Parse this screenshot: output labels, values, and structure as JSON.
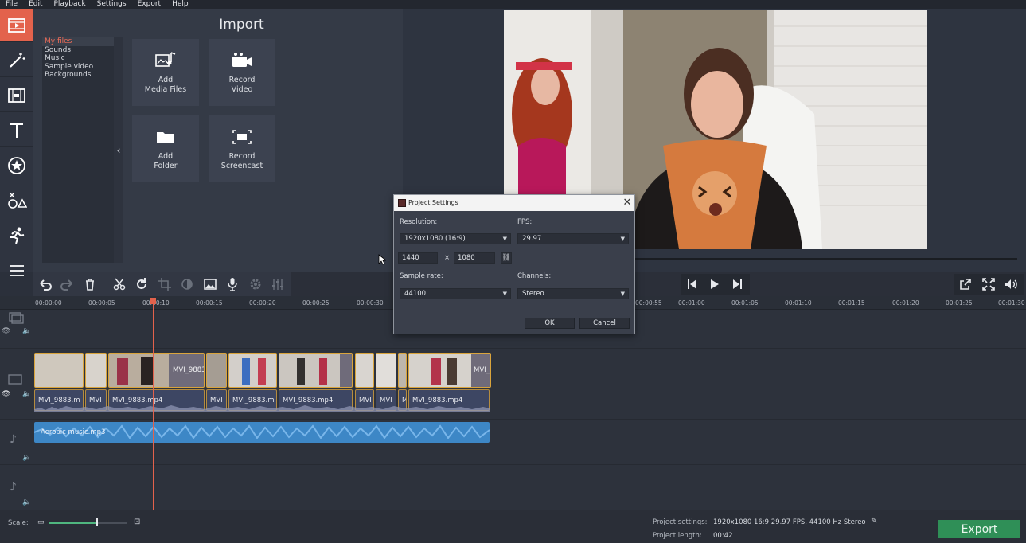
{
  "menu": [
    "File",
    "Edit",
    "Playback",
    "Settings",
    "Export",
    "Help"
  ],
  "import_panel": {
    "title": "Import",
    "file_list": [
      "My files",
      "Sounds",
      "Music",
      "Sample video",
      "Backgrounds"
    ],
    "tiles": [
      {
        "label": "Add\nMedia Files",
        "icon": "media-files-icon"
      },
      {
        "label": "Record\nVideo",
        "icon": "camera-icon"
      },
      {
        "label": "Add\nFolder",
        "icon": "folder-icon"
      },
      {
        "label": "Record\nScreencast",
        "icon": "screencast-icon"
      }
    ]
  },
  "ruler": [
    "00:00:00",
    "00:00:05",
    "00:00:10",
    "00:00:15",
    "00:00:20",
    "00:00:25",
    "00:00:30",
    "00:00:55",
    "00:01:00",
    "00:01:05",
    "00:01:10",
    "00:01:15",
    "00:01:20",
    "00:01:25",
    "00:01:30"
  ],
  "clips": {
    "video_label": "MVI_9883",
    "audio_labels": [
      "MVI_9883.m",
      "MVI",
      "MVI_9883.mp4",
      "MVI",
      "MVI_9883.m",
      "MVI_9883.mp4",
      "MVI",
      "MVI",
      "M",
      "MVI_9883.mp4"
    ],
    "music": "Aerobic music.mp3"
  },
  "dialog": {
    "title": "Project Settings",
    "resolution_label": "Resolution:",
    "resolution_value": "1920x1080 (16:9)",
    "fps_label": "FPS:",
    "fps_value": "29.97",
    "width": "1440",
    "times": "×",
    "height": "1080",
    "sample_rate_label": "Sample rate:",
    "sample_rate_value": "44100",
    "channels_label": "Channels:",
    "channels_value": "Stereo",
    "ok": "OK",
    "cancel": "Cancel"
  },
  "status": {
    "scale_label": "Scale:",
    "project_settings_label": "Project settings:",
    "project_settings_value": "1920x1080 16:9 29.97 FPS, 44100 Hz Stereo",
    "project_length_label": "Project length:",
    "project_length_value": "00:42",
    "scale_level": 0.6
  },
  "export_label": "Export"
}
